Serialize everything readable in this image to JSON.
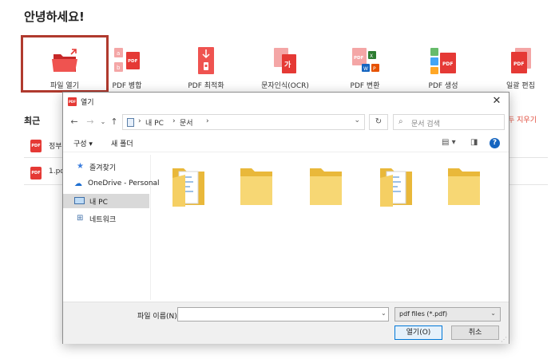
{
  "app": {
    "greeting": "안녕하세요!",
    "tools": [
      {
        "label": "파일 열기",
        "icon": "open-folder-icon"
      },
      {
        "label": "PDF 병합",
        "icon": "pdf-merge-icon"
      },
      {
        "label": "PDF 최적화",
        "icon": "pdf-optimize-icon"
      },
      {
        "label": "문자인식(OCR)",
        "icon": "ocr-icon"
      },
      {
        "label": "PDF 변환",
        "icon": "pdf-convert-icon"
      },
      {
        "label": "PDF 생성",
        "icon": "pdf-create-icon"
      },
      {
        "label": "일괄 편집",
        "icon": "batch-edit-icon"
      }
    ],
    "recent": {
      "title": "최근",
      "clear_label": "두 지우기",
      "items": [
        {
          "name": "정부"
        },
        {
          "name": "1.pd"
        }
      ]
    },
    "colors": {
      "accent": "#e53935",
      "highlight_border": "#b03a2e"
    }
  },
  "dialog": {
    "title": "열기",
    "app_icon_text": "PDF",
    "breadcrumb": [
      "내 PC",
      "문서"
    ],
    "search_placeholder": "문서 검색",
    "commands": {
      "organize": "구성 ▾",
      "new_folder": "새 폴더"
    },
    "help": "?",
    "nav": [
      {
        "label": "즐겨찾기",
        "icon": "star-pin-icon"
      },
      {
        "label": "OneDrive - Personal",
        "icon": "cloud-icon"
      },
      {
        "label": "내 PC",
        "icon": "computer-icon",
        "selected": true
      },
      {
        "label": "네트워크",
        "icon": "network-icon"
      }
    ],
    "folders": [
      {
        "kind": "documents"
      },
      {
        "kind": "plain"
      },
      {
        "kind": "plain"
      },
      {
        "kind": "documents"
      },
      {
        "kind": "plain"
      }
    ],
    "filename": {
      "label": "파일 이름(N):",
      "value": ""
    },
    "filter": "pdf files (*.pdf)",
    "buttons": {
      "open": "열기(O)",
      "cancel": "취소"
    }
  }
}
